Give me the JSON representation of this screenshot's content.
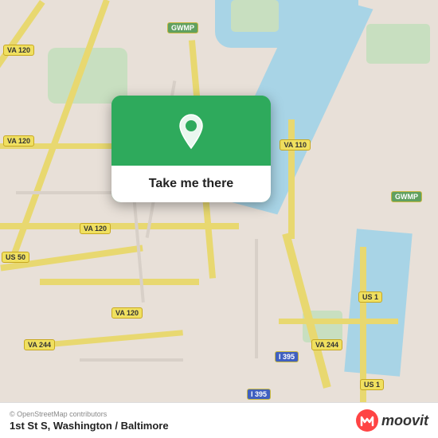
{
  "map": {
    "attribution": "© OpenStreetMap contributors",
    "location_name": "1st St S, Washington / Baltimore"
  },
  "popup": {
    "button_label": "Take me there"
  },
  "moovit": {
    "logo_text": "moovit"
  },
  "road_labels": {
    "va120_1": "VA 120",
    "va120_2": "VA 120",
    "va120_3": "VA 120",
    "va120_4": "VA 120",
    "va110": "VA 110",
    "va244_1": "VA 244",
    "va244_2": "VA 244",
    "us50": "US 50",
    "us1_1": "US 1",
    "us1_2": "US 1",
    "i395_1": "I 395",
    "i395_2": "I 395",
    "gwmp1": "GWMP",
    "gwmp2": "GWMP"
  }
}
